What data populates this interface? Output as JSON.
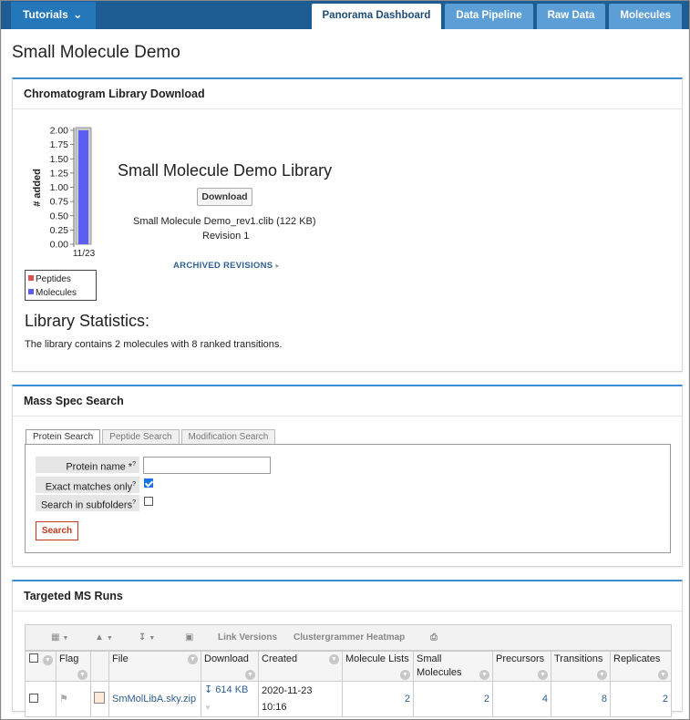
{
  "nav": {
    "tutorials_label": "Tutorials",
    "tabs": [
      {
        "label": "Panorama Dashboard",
        "active": true
      },
      {
        "label": "Data Pipeline",
        "active": false
      },
      {
        "label": "Raw Data",
        "active": false
      },
      {
        "label": "Molecules",
        "active": false
      }
    ]
  },
  "page_title": "Small Molecule Demo",
  "chromatogram": {
    "title": "Chromatogram Library Download",
    "library_name": "Small Molecule Demo Library",
    "download_label": "Download",
    "file_info": "Small Molecule Demo_rev1.clib (122 KB)",
    "revision": "Revision 1",
    "archived_label": "ARCHIVED REVISIONS",
    "stats_heading": "Library Statistics:",
    "stats_text": "The library contains 2 molecules with 8 ranked transitions."
  },
  "chart_data": {
    "type": "bar",
    "categories": [
      "11/23"
    ],
    "series": [
      {
        "name": "Peptides",
        "values": [
          0
        ],
        "color": "#e05050"
      },
      {
        "name": "Molecules",
        "values": [
          2
        ],
        "color": "#5b5ef0"
      }
    ],
    "ylabel": "# added",
    "yticks": [
      "0.00",
      "0.25",
      "0.50",
      "0.75",
      "1.00",
      "1.25",
      "1.50",
      "1.75",
      "2.00"
    ],
    "ylim": [
      0,
      2
    ]
  },
  "mass_spec": {
    "title": "Mass Spec Search",
    "tabs": [
      "Protein Search",
      "Peptide Search",
      "Modification Search"
    ],
    "protein_name_label": "Protein name *",
    "exact_label": "Exact matches only",
    "exact_checked": true,
    "subfolders_label": "Search in subfolders",
    "subfolders_checked": false,
    "help_mark": "?",
    "search_label": "Search"
  },
  "runs": {
    "title": "Targeted MS Runs",
    "toolbar": {
      "link_versions": "Link Versions",
      "clustergrammer": "Clustergrammer Heatmap"
    },
    "columns": [
      "Flag",
      "File",
      "Download",
      "Created",
      "Molecule Lists",
      "Small Molecules",
      "Precursors",
      "Transitions",
      "Replicates"
    ],
    "rows": [
      {
        "file": "SmMolLibA.sky.zip",
        "download": "614 KB",
        "created": "2020-11-23 10:16",
        "molecule_lists": "2",
        "small_molecules": "2",
        "precursors": "4",
        "transitions": "8",
        "replicates": "2"
      }
    ]
  }
}
